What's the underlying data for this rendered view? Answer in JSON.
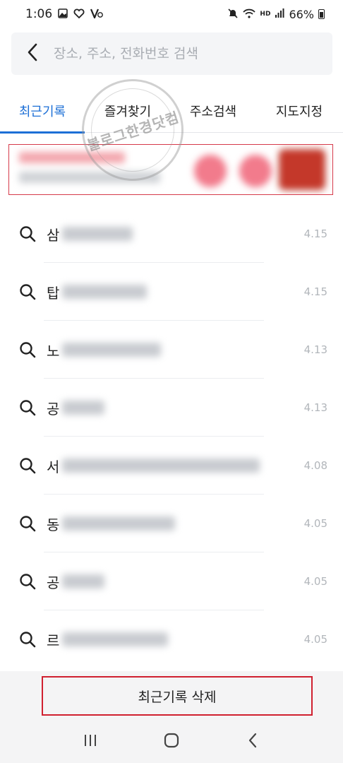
{
  "status_bar": {
    "time": "1:06",
    "battery": "66%",
    "hd_label": "HD"
  },
  "search": {
    "placeholder": "장소, 주소, 전화번호 검색",
    "value": ""
  },
  "tabs": [
    {
      "label": "최근기록",
      "active": true
    },
    {
      "label": "즐겨찾기",
      "active": false
    },
    {
      "label": "주소검색",
      "active": false
    },
    {
      "label": "지도지정",
      "active": false
    }
  ],
  "watermark": {
    "text": "블로그한경닷컴"
  },
  "history": [
    {
      "name_prefix": "삼",
      "date": "4.15"
    },
    {
      "name_prefix": "탑",
      "date": "4.15"
    },
    {
      "name_prefix": "노",
      "date": "4.13"
    },
    {
      "name_prefix": "공",
      "date": "4.13"
    },
    {
      "name_prefix": "서",
      "date": "4.08"
    },
    {
      "name_prefix": "동",
      "date": "4.05"
    },
    {
      "name_prefix": "공",
      "date": "4.05"
    },
    {
      "name_prefix": "르",
      "date": "4.05"
    }
  ],
  "delete_button": {
    "label": "최근기록 삭제"
  },
  "colors": {
    "accent": "#1d6fd6",
    "highlight_border": "#d0202f"
  },
  "icons": {
    "back": "back-arrow-icon",
    "search": "search-icon",
    "nav_recents": "recents-icon",
    "nav_home": "home-icon",
    "nav_back": "nav-back-icon"
  }
}
